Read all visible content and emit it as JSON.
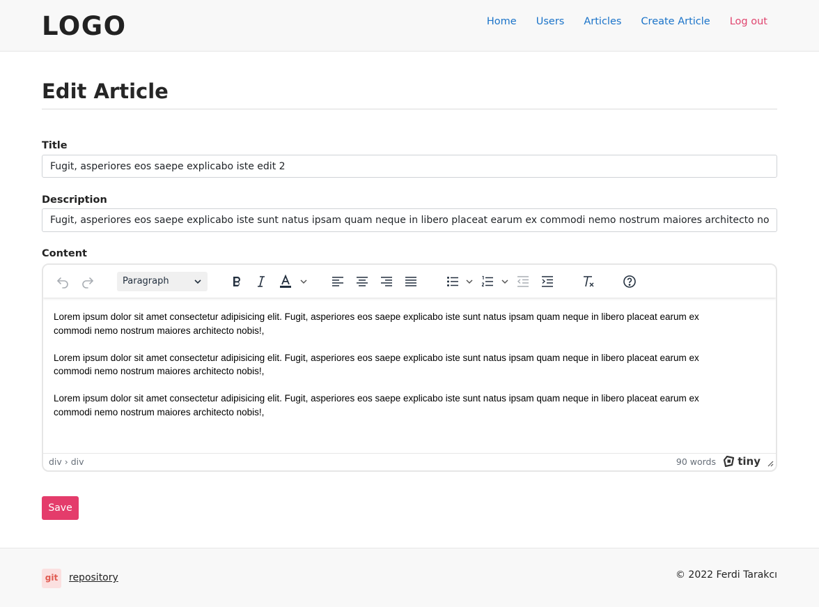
{
  "header": {
    "logo": "LOGO",
    "nav": {
      "home": "Home",
      "users": "Users",
      "articles": "Articles",
      "create_article": "Create Article",
      "logout": "Log out"
    }
  },
  "page": {
    "title": "Edit Article"
  },
  "form": {
    "title_label": "Title",
    "title_value": "Fugit, asperiores eos saepe explicabo iste edit 2",
    "description_label": "Description",
    "description_value": "Fugit, asperiores eos saepe explicabo iste sunt natus ipsam quam neque in libero placeat earum ex commodi nemo nostrum maiores architecto nobis!",
    "content_label": "Content",
    "save_label": "Save"
  },
  "editor": {
    "block_format": "Paragraph",
    "paragraphs": [
      "Lorem ipsum dolor sit amet consectetur adipisicing elit. Fugit, asperiores eos saepe explicabo iste sunt natus ipsam quam neque in libero placeat earum ex commodi nemo nostrum maiores architecto nobis!,",
      "Lorem ipsum dolor sit amet consectetur adipisicing elit. Fugit, asperiores eos saepe explicabo iste sunt natus ipsam quam neque in libero placeat earum ex commodi nemo nostrum maiores architecto nobis!,",
      "Lorem ipsum dolor sit amet consectetur adipisicing elit. Fugit, asperiores eos saepe explicabo iste sunt natus ipsam quam neque in libero placeat earum ex commodi nemo nostrum maiores architecto nobis!,"
    ],
    "status_path": "div › div",
    "word_count": "90 words",
    "brand": "tiny",
    "toolbar_icons": [
      "undo-icon",
      "redo-icon",
      "bold-icon",
      "italic-icon",
      "text-color-icon",
      "align-left-icon",
      "align-center-icon",
      "align-right-icon",
      "align-justify-icon",
      "bullet-list-icon",
      "numbered-list-icon",
      "outdent-icon",
      "indent-icon",
      "clear-formatting-icon",
      "help-icon"
    ]
  },
  "footer": {
    "git_badge": "git",
    "repository_link": "repository",
    "copyright": "© 2022 Ferdi Tarakcı"
  },
  "colors": {
    "link": "#1a73c9",
    "logout": "#e0456f",
    "save_button": "#e43c6b",
    "text_color_underline": "#222f3e"
  }
}
